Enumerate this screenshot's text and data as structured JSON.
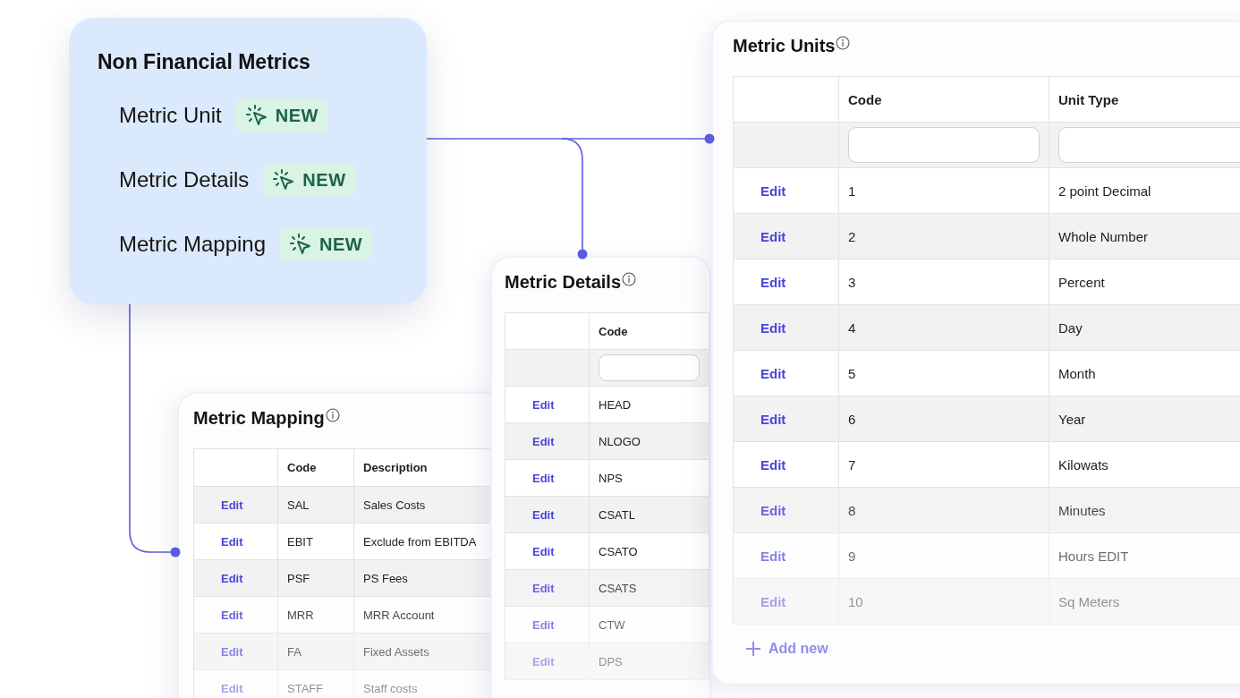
{
  "menu": {
    "title": "Non Financial Metrics",
    "items": [
      {
        "label": "Metric Unit",
        "badge": "NEW"
      },
      {
        "label": "Metric Details",
        "badge": "NEW"
      },
      {
        "label": "Metric Mapping",
        "badge": "NEW"
      }
    ]
  },
  "metric_mapping": {
    "title": "Metric Mapping",
    "columns": [
      "Code",
      "Description"
    ],
    "rows": [
      {
        "action": "Edit",
        "cells": [
          "SAL",
          "Sales Costs"
        ]
      },
      {
        "action": "Edit",
        "cells": [
          "EBIT",
          "Exclude from EBITDA"
        ]
      },
      {
        "action": "Edit",
        "cells": [
          "PSF",
          "PS Fees"
        ]
      },
      {
        "action": "Edit",
        "cells": [
          "MRR",
          "MRR Account"
        ]
      },
      {
        "action": "Edit",
        "cells": [
          "FA",
          "Fixed Assets"
        ]
      },
      {
        "action": "Edit",
        "cells": [
          "STAFF",
          "Staff costs"
        ]
      }
    ]
  },
  "metric_details": {
    "title": "Metric Details",
    "columns": [
      "Code"
    ],
    "filters": true,
    "rows": [
      {
        "action": "Edit",
        "cells": [
          "HEAD"
        ]
      },
      {
        "action": "Edit",
        "cells": [
          "NLOGO"
        ]
      },
      {
        "action": "Edit",
        "cells": [
          "NPS"
        ]
      },
      {
        "action": "Edit",
        "cells": [
          "CSATL"
        ]
      },
      {
        "action": "Edit",
        "cells": [
          "CSATO"
        ]
      },
      {
        "action": "Edit",
        "cells": [
          "CSATS"
        ]
      },
      {
        "action": "Edit",
        "cells": [
          "CTW"
        ]
      },
      {
        "action": "Edit",
        "cells": [
          "DPS"
        ]
      }
    ]
  },
  "metric_units": {
    "title": "Metric Units",
    "columns": [
      "Code",
      "Unit Type"
    ],
    "filters": true,
    "rows": [
      {
        "action": "Edit",
        "cells": [
          "1",
          "2 point Decimal"
        ]
      },
      {
        "action": "Edit",
        "cells": [
          "2",
          "Whole Number"
        ]
      },
      {
        "action": "Edit",
        "cells": [
          "3",
          "Percent"
        ]
      },
      {
        "action": "Edit",
        "cells": [
          "4",
          "Day"
        ]
      },
      {
        "action": "Edit",
        "cells": [
          "5",
          "Month"
        ]
      },
      {
        "action": "Edit",
        "cells": [
          "6",
          "Year"
        ]
      },
      {
        "action": "Edit",
        "cells": [
          "7",
          "Kilowats"
        ]
      },
      {
        "action": "Edit",
        "cells": [
          "8",
          "Minutes"
        ]
      },
      {
        "action": "Edit",
        "cells": [
          "9",
          "Hours EDIT"
        ]
      },
      {
        "action": "Edit",
        "cells": [
          "10",
          "Sq Meters"
        ]
      }
    ],
    "add_label": "Add new"
  }
}
